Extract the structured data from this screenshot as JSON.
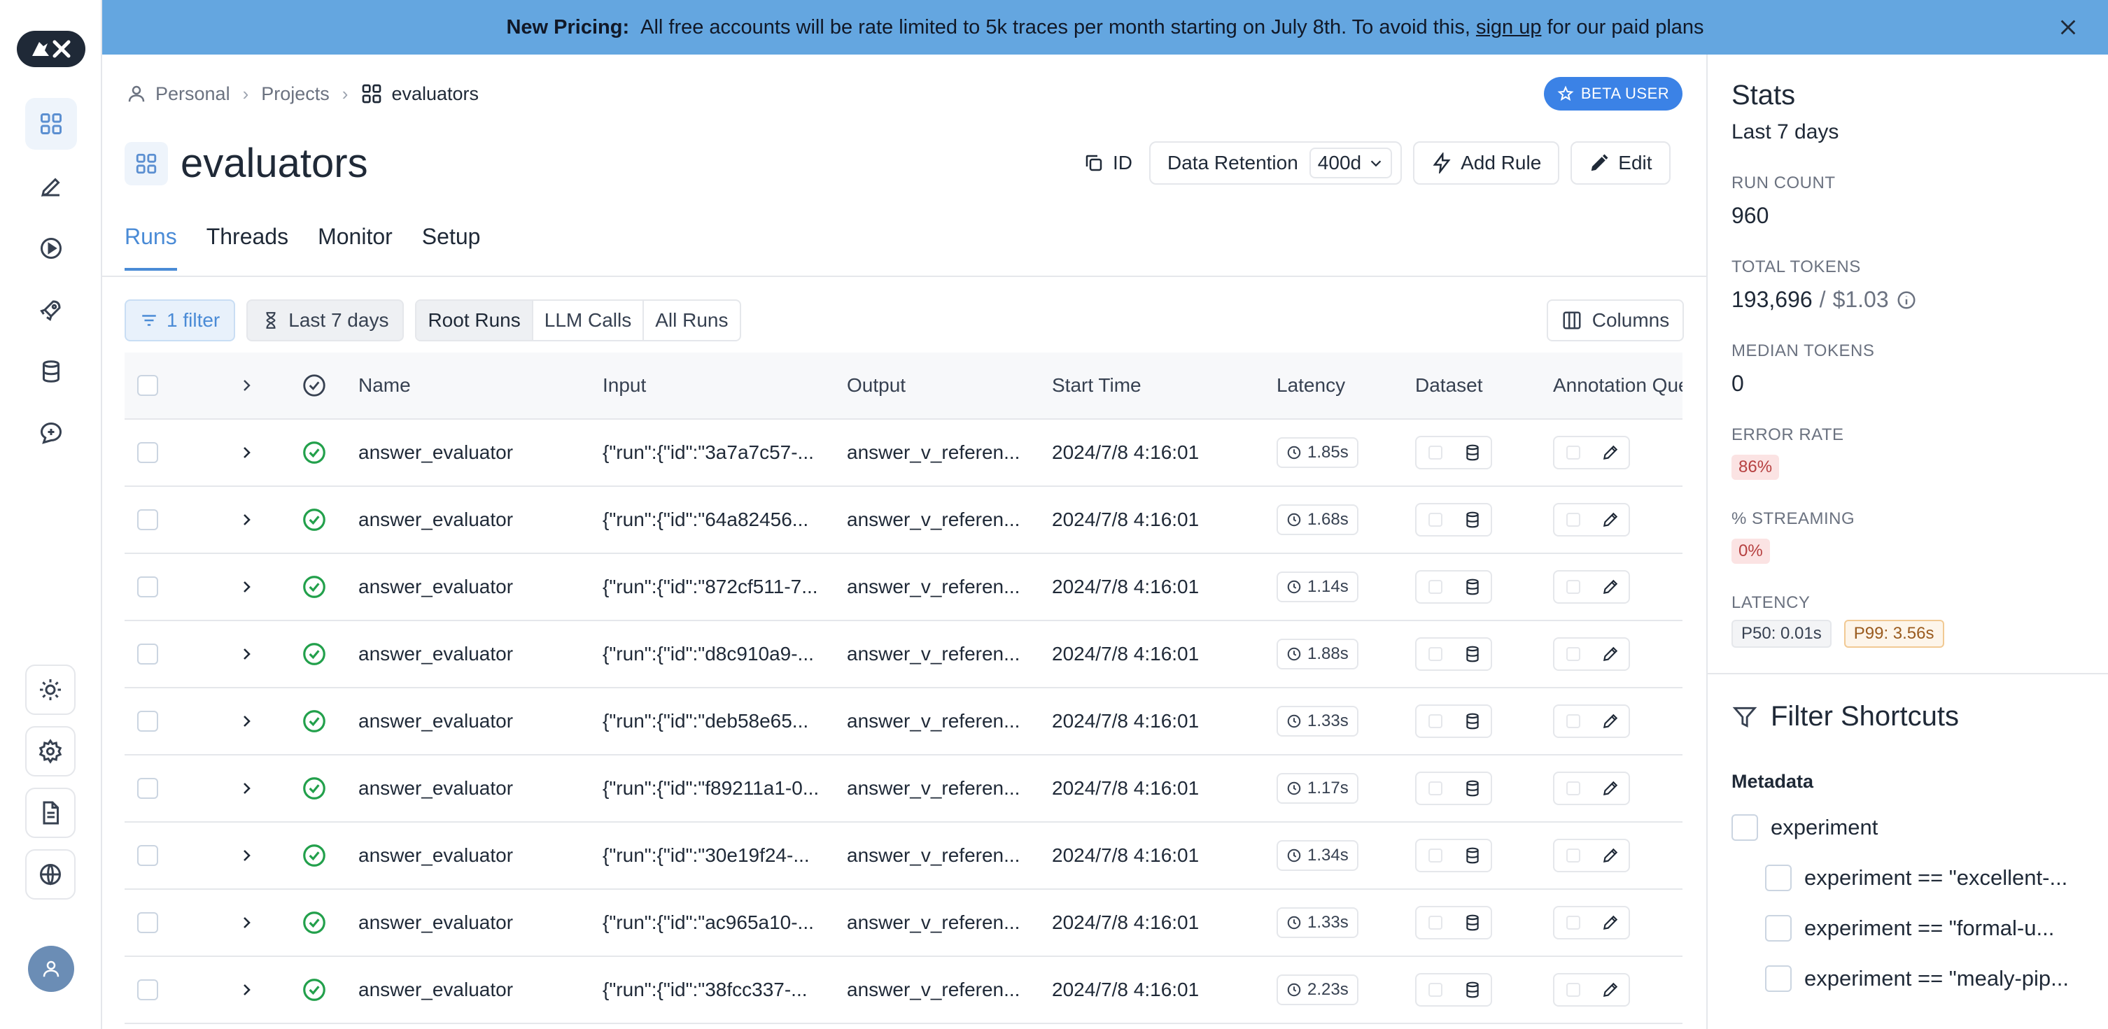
{
  "banner": {
    "bold": "New Pricing:",
    "text": "All free accounts will be rate limited to 5k traces per month starting on July 8th. To avoid this,",
    "link": "sign up",
    "text_after": "for our paid plans"
  },
  "breadcrumb": {
    "personal": "Personal",
    "projects": "Projects",
    "current": "evaluators"
  },
  "beta_badge": "BETA USER",
  "project": {
    "title": "evaluators"
  },
  "actions": {
    "id_label": "ID",
    "data_retention_label": "Data Retention",
    "data_retention_value": "400d",
    "add_rule": "Add Rule",
    "edit": "Edit"
  },
  "tabs": [
    {
      "label": "Runs",
      "active": true
    },
    {
      "label": "Threads",
      "active": false
    },
    {
      "label": "Monitor",
      "active": false
    },
    {
      "label": "Setup",
      "active": false
    }
  ],
  "filters": {
    "filter_label": "1 filter",
    "time_label": "Last 7 days",
    "segments": [
      "Root Runs",
      "LLM Calls",
      "All Runs"
    ],
    "columns_label": "Columns"
  },
  "table": {
    "headers": {
      "name": "Name",
      "input": "Input",
      "output": "Output",
      "start_time": "Start Time",
      "latency": "Latency",
      "dataset": "Dataset",
      "annotation": "Annotation Queue"
    },
    "rows": [
      {
        "name": "answer_evaluator",
        "input": "{\"run\":{\"id\":\"3a7a7c57-...",
        "output": "answer_v_referen...",
        "start_time": "2024/7/8 4:16:01",
        "latency": "1.85s"
      },
      {
        "name": "answer_evaluator",
        "input": "{\"run\":{\"id\":\"64a82456...",
        "output": "answer_v_referen...",
        "start_time": "2024/7/8 4:16:01",
        "latency": "1.68s"
      },
      {
        "name": "answer_evaluator",
        "input": "{\"run\":{\"id\":\"872cf511-7...",
        "output": "answer_v_referen...",
        "start_time": "2024/7/8 4:16:01",
        "latency": "1.14s"
      },
      {
        "name": "answer_evaluator",
        "input": "{\"run\":{\"id\":\"d8c910a9-...",
        "output": "answer_v_referen...",
        "start_time": "2024/7/8 4:16:01",
        "latency": "1.88s"
      },
      {
        "name": "answer_evaluator",
        "input": "{\"run\":{\"id\":\"deb58e65...",
        "output": "answer_v_referen...",
        "start_time": "2024/7/8 4:16:01",
        "latency": "1.33s"
      },
      {
        "name": "answer_evaluator",
        "input": "{\"run\":{\"id\":\"f89211a1-0...",
        "output": "answer_v_referen...",
        "start_time": "2024/7/8 4:16:01",
        "latency": "1.17s"
      },
      {
        "name": "answer_evaluator",
        "input": "{\"run\":{\"id\":\"30e19f24-...",
        "output": "answer_v_referen...",
        "start_time": "2024/7/8 4:16:01",
        "latency": "1.34s"
      },
      {
        "name": "answer_evaluator",
        "input": "{\"run\":{\"id\":\"ac965a10-...",
        "output": "answer_v_referen...",
        "start_time": "2024/7/8 4:16:01",
        "latency": "1.33s"
      },
      {
        "name": "answer_evaluator",
        "input": "{\"run\":{\"id\":\"38fcc337-...",
        "output": "answer_v_referen...",
        "start_time": "2024/7/8 4:16:01",
        "latency": "2.23s"
      }
    ]
  },
  "stats": {
    "title": "Stats",
    "period": "Last 7 days",
    "run_count_label": "RUN COUNT",
    "run_count": "960",
    "total_tokens_label": "TOTAL TOKENS",
    "total_tokens": "193,696",
    "total_tokens_sep": "/",
    "total_cost": "$1.03",
    "median_tokens_label": "MEDIAN TOKENS",
    "median_tokens": "0",
    "error_rate_label": "ERROR RATE",
    "error_rate": "86%",
    "streaming_label": "% STREAMING",
    "streaming": "0%",
    "latency_label": "LATENCY",
    "p50": "P50: 0.01s",
    "p99": "P99: 3.56s"
  },
  "filter_shortcuts": {
    "title": "Filter Shortcuts",
    "section": "Metadata",
    "parent": "experiment",
    "children": [
      "experiment == \"excellent-...",
      "experiment == \"formal-u...",
      "experiment == \"mealy-pip..."
    ]
  },
  "colors": {
    "banner": "#64a6e0",
    "accent": "#4a8bd6",
    "success": "#22a04b",
    "beta": "#3b82e6"
  }
}
